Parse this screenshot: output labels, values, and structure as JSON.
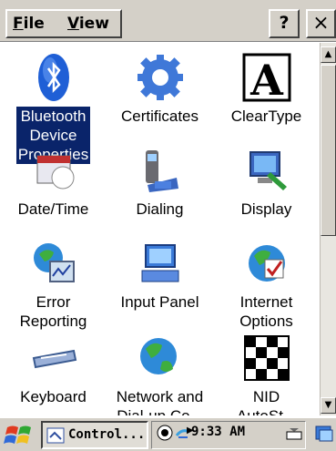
{
  "menu": {
    "file": "File",
    "file_ul": "F",
    "file_rest": "ile",
    "view": "View",
    "view_ul": "V",
    "view_rest": "iew"
  },
  "window_buttons": {
    "help": "?",
    "close": "×"
  },
  "items": [
    {
      "label_lines": [
        "Bluetooth",
        "Device",
        "Properties"
      ],
      "selected": true,
      "icon": "bluetooth-icon"
    },
    {
      "label_lines": [
        "Certificates"
      ],
      "icon": "certificates-icon"
    },
    {
      "label_lines": [
        "ClearType"
      ],
      "icon": "cleartype-icon"
    },
    {
      "label_lines": [
        "Date/Time"
      ],
      "icon": "date-time-icon"
    },
    {
      "label_lines": [
        "Dialing"
      ],
      "icon": "dialing-icon"
    },
    {
      "label_lines": [
        "Display"
      ],
      "icon": "display-icon"
    },
    {
      "label_lines": [
        "Error",
        "Reporting"
      ],
      "icon": "error-reporting-icon"
    },
    {
      "label_lines": [
        "Input Panel"
      ],
      "icon": "input-panel-icon"
    },
    {
      "label_lines": [
        "Internet",
        "Options"
      ],
      "icon": "internet-options-icon"
    },
    {
      "label_lines": [
        "Keyboard"
      ],
      "icon": "keyboard-icon"
    },
    {
      "label_lines": [
        "Network and",
        "Dial-up Co..."
      ],
      "icon": "network-icon"
    },
    {
      "label_lines": [
        "NID",
        "AutoSt..."
      ],
      "icon": "nid-icon"
    }
  ],
  "taskbar": {
    "task_label": "Control...",
    "clock": "9:33 AM"
  },
  "colors": {
    "selection": "#0a246a",
    "chrome": "#d4d0c8"
  }
}
